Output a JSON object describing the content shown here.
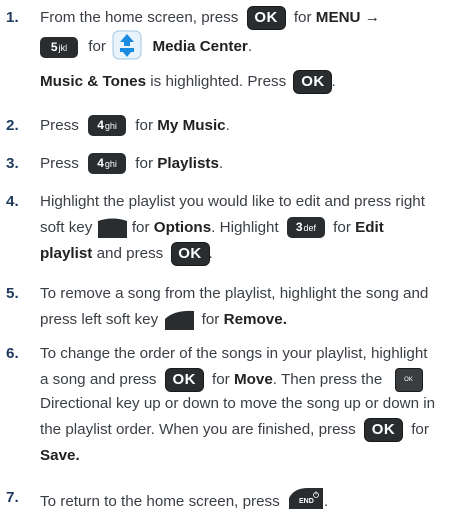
{
  "keys": {
    "ok": "OK",
    "num5": "5",
    "num5_sub": "jkl",
    "num4": "4",
    "num4_sub": "ghi",
    "num3": "3",
    "num3_sub": "def",
    "dir_ok": "OK",
    "end": "END"
  },
  "steps": [
    {
      "num": "1.",
      "l1": [
        "From the home screen, press",
        "for",
        "MENU",
        "→"
      ],
      "l2": [
        "for",
        "Media Center",
        "."
      ],
      "l3": [
        "Music & Tones",
        "is highlighted. Press",
        "."
      ]
    },
    {
      "num": "2.",
      "l1": [
        "Press",
        "for",
        "My Music",
        "."
      ]
    },
    {
      "num": "3.",
      "l1": [
        "Press",
        "for",
        "Playlists",
        "."
      ]
    },
    {
      "num": "4.",
      "l1": [
        "Highlight the playlist you would like to edit and press right"
      ],
      "l2": [
        "soft key",
        "for",
        "Options",
        ". Highlight",
        "for",
        "Edit"
      ],
      "l3": [
        "playlist",
        "and press",
        "."
      ]
    },
    {
      "num": "5.",
      "l1": [
        "To remove a song from the playlist, highlight the song and"
      ],
      "l2": [
        "press left soft key",
        "for",
        "Remove."
      ]
    },
    {
      "num": "6.",
      "l1": [
        "To change the order of the songs in your playlist, highlight"
      ],
      "l2": [
        "a song and press",
        "for",
        "Move",
        ". Then press the"
      ],
      "l3": [
        "Directional key up or down to move the song up or down in"
      ],
      "l4": [
        "the playlist order. When you are finished, press",
        "for"
      ],
      "l5": [
        "Save."
      ]
    },
    {
      "num": "7.",
      "l1": [
        "To return to the home screen, press",
        "."
      ]
    }
  ]
}
